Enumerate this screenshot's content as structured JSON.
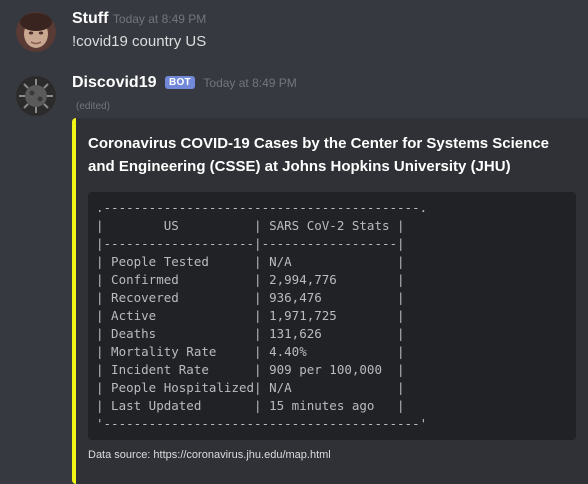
{
  "messages": [
    {
      "username": "Stuff",
      "timestamp": "Today at 8:49 PM",
      "text": "!covid19 country US"
    },
    {
      "username": "Discovid19",
      "badge": "BOT",
      "timestamp": "Today at 8:49 PM",
      "edited": "(edited)",
      "embed": {
        "accent_color": "#f1f416",
        "title": "Coronavirus COVID-19 Cases by the Center for Systems Science and Engineering (CSSE) at Johns Hopkins University (JHU)",
        "code": ".------------------------------------------.\n|        US          | SARS CoV-2 Stats |\n|--------------------|------------------|\n| People Tested      | N/A              |\n| Confirmed          | 2,994,776        |\n| Recovered          | 936,476          |\n| Active             | 1,971,725        |\n| Deaths             | 131,626          |\n| Mortality Rate     | 4.40%            |\n| Incident Rate      | 909 per 100,000  |\n| People Hospitalized| N/A              |\n| Last Updated       | 15 minutes ago   |\n'------------------------------------------'",
        "footer": "Data source: https://coronavirus.jhu.edu/map.html"
      }
    }
  ]
}
